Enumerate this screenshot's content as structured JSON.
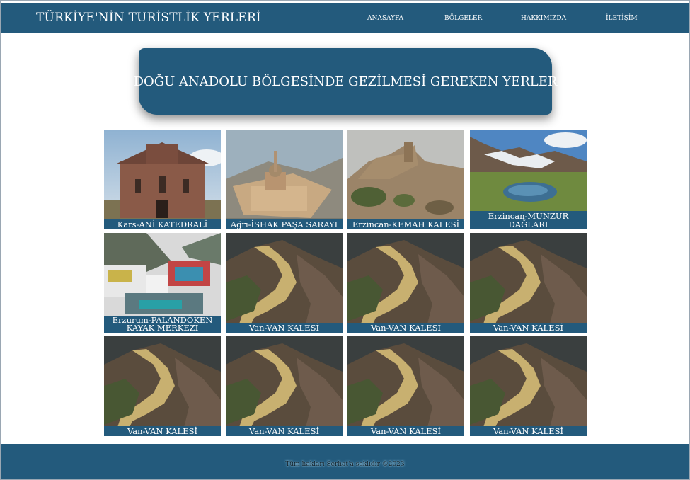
{
  "header": {
    "brand": "TÜRKİYE'NİN TURİSTLİK YERLERİ",
    "nav": [
      "ANASAYFA",
      "BÖLGELER",
      "HAKKIMIZDA",
      "İLETİŞİM"
    ]
  },
  "hero": {
    "title": "DOĞU ANADOLU BÖLGESİNDE GEZİLMESİ GEREKEN YERLER"
  },
  "cards": [
    {
      "caption": "Kars-ANİ KATEDRALİ",
      "image": "cathedral"
    },
    {
      "caption": "Ağrı-İSHAK PAŞA SARAYI",
      "image": "palace"
    },
    {
      "caption": "Erzincan-KEMAH KALESİ",
      "image": "ruin"
    },
    {
      "caption": "Erzincan-MUNZUR DAĞLARI",
      "image": "mountain"
    },
    {
      "caption": "Erzurum-PALANDÖKEN KAYAK MERKEZİ",
      "image": "ski"
    },
    {
      "caption": "Van-VAN KALESİ",
      "image": "fortress"
    },
    {
      "caption": "Van-VAN KALESİ",
      "image": "fortress"
    },
    {
      "caption": "Van-VAN KALESİ",
      "image": "fortress"
    },
    {
      "caption": "Van-VAN KALESİ",
      "image": "fortress"
    },
    {
      "caption": "Van-VAN KALESİ",
      "image": "fortress"
    },
    {
      "caption": "Van-VAN KALESİ",
      "image": "fortress"
    },
    {
      "caption": "Van-VAN KALESİ",
      "image": "fortress"
    }
  ],
  "footer": {
    "copyright": "Tüm hakları Serhat'a saklıdır ©2023"
  },
  "colors": {
    "primary": "#235a7c",
    "background": "#ffffff"
  }
}
